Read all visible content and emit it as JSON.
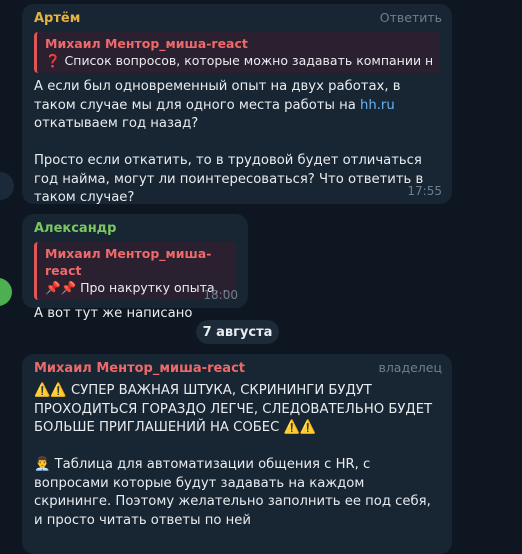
{
  "messages": [
    {
      "sender": "Артём",
      "sender_color": "#e3b341",
      "action": "Ответить",
      "quote_author": "Михаил Ментор_миша-react",
      "quote_text": "❓ Список вопросов, которые можно задавать компании на ...",
      "text_before_link": "А если был одновременный опыт на двух работах, в таком случае мы для одного места работы на ",
      "link": "hh.ru",
      "text_after_link": " откатываем год назад?\n\nПросто если откатить, то в трудовой будет отличаться год найма, могут ли поинтересоваться? Что ответить в таком случае?",
      "time": "17:55"
    },
    {
      "sender": "Александр",
      "sender_color": "#7bc862",
      "quote_author": "Михаил Ментор_миша-react",
      "quote_text": "📌📌 Про накрутку опыта, ...",
      "text": "А вот тут же написано",
      "time": "18:00"
    },
    {
      "sender": "Михаил Ментор_миша-react",
      "sender_color": "#ee6a6a",
      "tag": "владелец",
      "text": "⚠️⚠️ СУПЕР ВАЖНАЯ ШТУКА, СКРИНИНГИ БУДУТ ПРОХОДИТЬСЯ ГОРАЗДО ЛЕГЧЕ, СЛЕДОВАТЕЛЬНО БУДЕТ БОЛЬШЕ ПРИГЛАШЕНИЙ НА СОБЕС ⚠️⚠️\n\n👨‍💼 Таблица для автоматизации общения с HR, с вопросами которые будут задавать на каждом скрининге. Поэтому желательно заполнить ее под себя, и просто читать ответы по ней"
    }
  ],
  "date_separator": "7 августа",
  "colors": {
    "background": "#0e1621",
    "bubble": "#182533",
    "link": "#6ab2f2",
    "meta": "#6d7f8f"
  }
}
